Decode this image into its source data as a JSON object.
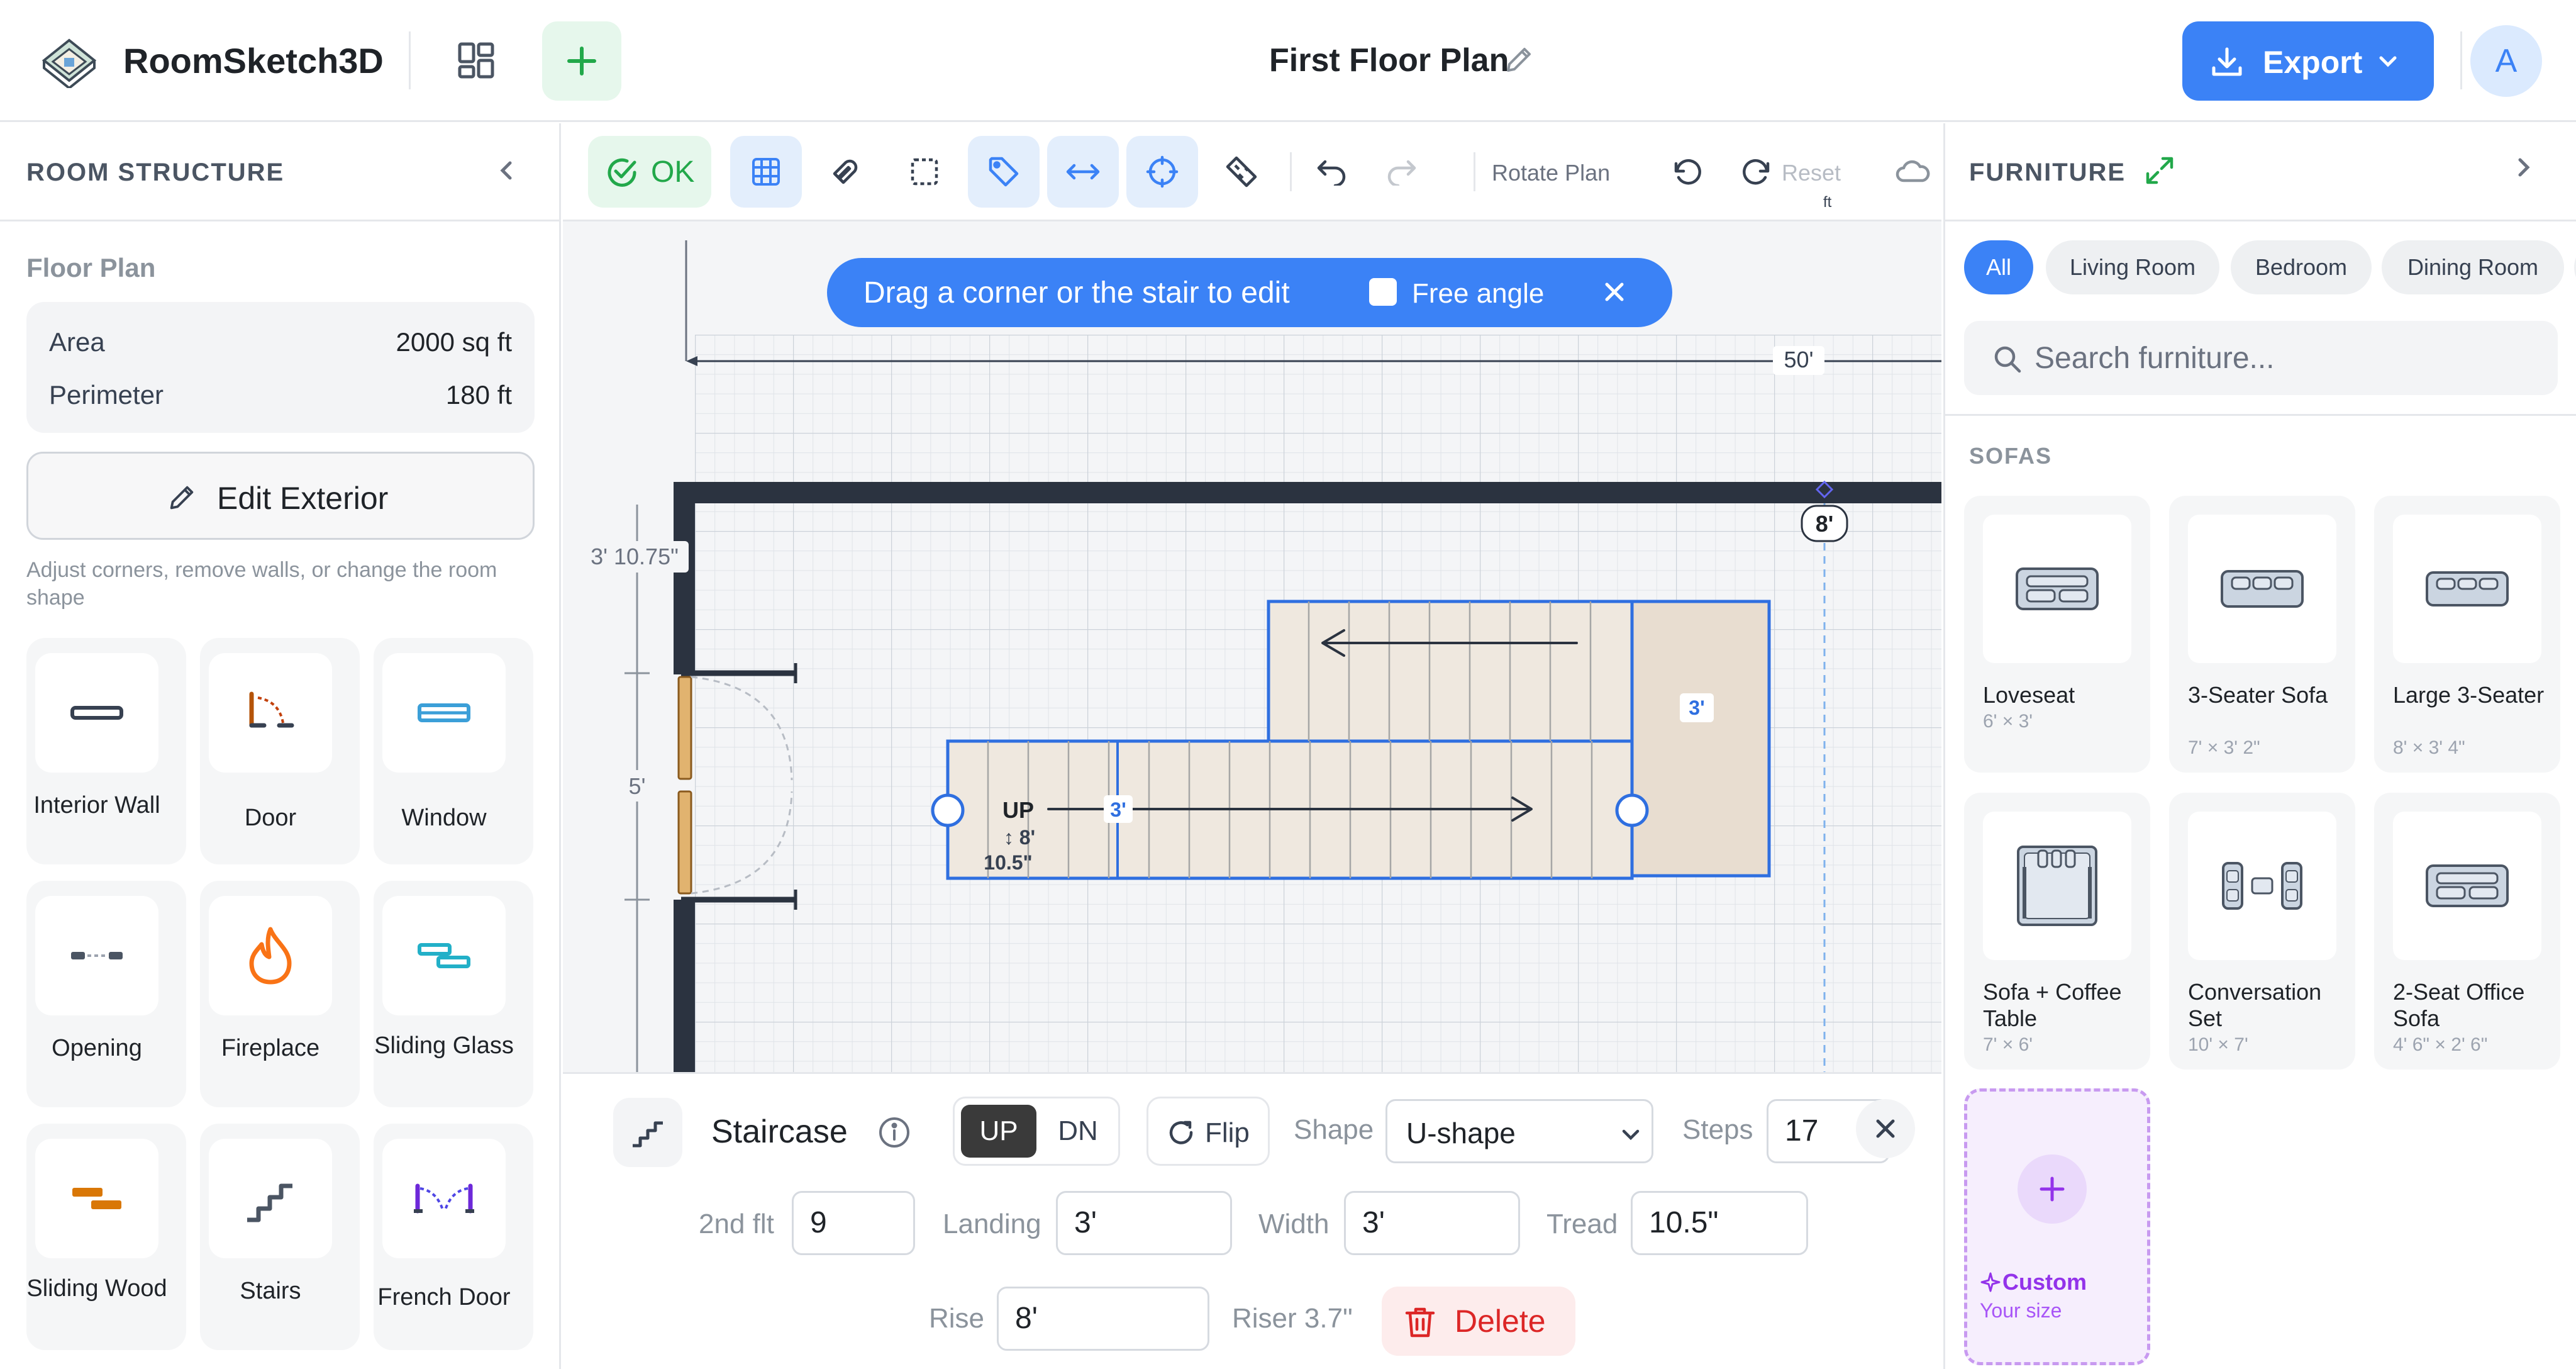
{
  "header": {
    "app_name": "RoomSketch3D",
    "doc_title": "First Floor Plan",
    "export_label": "Export",
    "avatar_initial": "A"
  },
  "left_panel": {
    "title": "ROOM STRUCTURE",
    "floor_plan_label": "Floor Plan",
    "stats": [
      {
        "label": "Area",
        "value": "2000 sq ft"
      },
      {
        "label": "Perimeter",
        "value": "180 ft"
      }
    ],
    "edit_exterior_label": "Edit Exterior",
    "edit_exterior_hint": "Adjust corners, remove walls, or change the room shape",
    "tools": [
      {
        "label": "Interior Wall",
        "icon": "interior-wall-icon"
      },
      {
        "label": "Door",
        "icon": "door-icon"
      },
      {
        "label": "Window",
        "icon": "window-icon"
      },
      {
        "label": "Opening",
        "icon": "opening-icon"
      },
      {
        "label": "Fireplace",
        "icon": "fireplace-icon"
      },
      {
        "label": "Sliding Glass",
        "icon": "sliding-glass-icon"
      },
      {
        "label": "Sliding Wood",
        "icon": "sliding-wood-icon"
      },
      {
        "label": "Stairs",
        "icon": "stairs-icon"
      },
      {
        "label": "French Door",
        "icon": "french-door-icon"
      }
    ]
  },
  "toolbar": {
    "ok_label": "OK",
    "rotate_label": "Rotate Plan",
    "reset_label": "Reset",
    "unit_label": "ft"
  },
  "canvas": {
    "banner_text": "Drag a corner or the stair to edit",
    "free_angle_label": "Free angle",
    "dim_top": "50'",
    "dim_left_upper": "3' 10.75\"",
    "dim_door": "5'",
    "dim_height_marker": "8'",
    "stair_up": "UP",
    "stair_rise_note": "↕ 8'",
    "stair_tread_note": "10.5\"",
    "stair_width_mark": "3'",
    "landing_width_mark": "3'"
  },
  "stair_editor": {
    "title": "Staircase",
    "up_label": "UP",
    "dn_label": "DN",
    "flip_label": "Flip",
    "shape_label": "Shape",
    "shape_value": "U-shape",
    "steps_label": "Steps",
    "steps_value": "17",
    "second_flt_label": "2nd flt",
    "second_flt_value": "9",
    "landing_label": "Landing",
    "landing_value": "3'",
    "width_label": "Width",
    "width_value": "3'",
    "tread_label": "Tread",
    "tread_value": "10.5\"",
    "rise_label": "Rise",
    "rise_value": "8'",
    "riser_note": "Riser 3.7\"",
    "delete_label": "Delete"
  },
  "right_panel": {
    "title": "FURNITURE",
    "categories": [
      "All",
      "Living Room",
      "Bedroom",
      "Dining Room"
    ],
    "search_placeholder": "Search furniture...",
    "section_title": "SOFAS",
    "items": [
      {
        "name": "Loveseat",
        "size": "6' × 3'"
      },
      {
        "name": "3-Seater Sofa",
        "size": "7' × 3' 2\""
      },
      {
        "name": "Large 3-Seater",
        "size": "8' × 3' 4\""
      },
      {
        "name": "Sofa + Coffee Table",
        "size": "7' × 6'"
      },
      {
        "name": "Conversation Set",
        "size": "10' × 7'"
      },
      {
        "name": "2-Seat Office Sofa",
        "size": "4' 6\" × 2' 6\""
      }
    ],
    "custom_title": "Custom",
    "custom_subtitle": "Your size"
  },
  "colors": {
    "accent": "#3b82f6",
    "success": "#22a84a",
    "danger": "#dc2626",
    "custom": "#9333ea",
    "wall": "#2b3340",
    "stair_fill": "#efe8df"
  }
}
